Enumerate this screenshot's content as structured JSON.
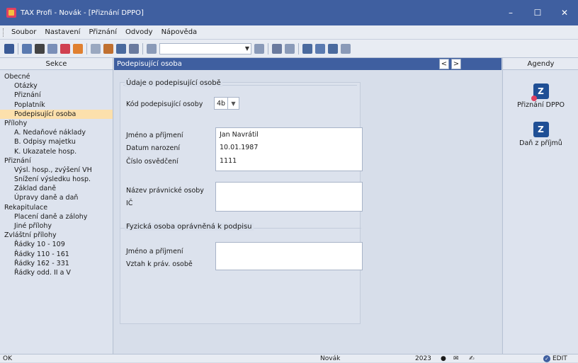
{
  "window": {
    "title": "TAX Profi - Novák - [Přiznání DPPO]",
    "minimize": "–",
    "maximize": "☐",
    "close": "✕"
  },
  "menu": [
    "Soubor",
    "Nastavení",
    "Přiznání",
    "Odvody",
    "Nápověda"
  ],
  "sekce": {
    "title": "Sekce",
    "items": [
      {
        "label": "Obecné",
        "level": 0
      },
      {
        "label": "Otázky",
        "level": 1
      },
      {
        "label": "Přiznání",
        "level": 1
      },
      {
        "label": "Poplatník",
        "level": 1
      },
      {
        "label": "Podepisující osoba",
        "level": 1,
        "selected": true
      },
      {
        "label": "Přílohy",
        "level": 0
      },
      {
        "label": "A. Nedaňové náklady",
        "level": 1
      },
      {
        "label": "B. Odpisy majetku",
        "level": 1
      },
      {
        "label": "K. Ukazatele hosp.",
        "level": 1
      },
      {
        "label": "Přiznání",
        "level": 0
      },
      {
        "label": "Výsl. hosp., zvýšení VH",
        "level": 1
      },
      {
        "label": "Snížení výsledku hosp.",
        "level": 1
      },
      {
        "label": "Základ daně",
        "level": 1
      },
      {
        "label": "Úpravy daně a daň",
        "level": 1
      },
      {
        "label": "Rekapitulace",
        "level": 0
      },
      {
        "label": "Placení daně a zálohy",
        "level": 1
      },
      {
        "label": "Jiné přílohy",
        "level": 1
      },
      {
        "label": "Zvláštní přílohy",
        "level": 0
      },
      {
        "label": "Řádky 10 - 109",
        "level": 1
      },
      {
        "label": "Řádky 110 - 161",
        "level": 1
      },
      {
        "label": "Řádky 162 - 331",
        "level": 1
      },
      {
        "label": "Řádky odd. II a V",
        "level": 1
      }
    ]
  },
  "main": {
    "title": "Podepisující osoba",
    "prev": "<",
    "next": ">",
    "group1": "Údaje o podepisující osobě",
    "kod_label": "Kód podepisující osoby",
    "kod_value": "4b",
    "jmeno_label": "Jméno a příjmení",
    "jmeno_value": "Jan Navrátil",
    "datum_label": "Datum narození",
    "datum_value": "10.01.1987",
    "cislo_label": "Číslo osvědčení",
    "cislo_value": "1111",
    "nazev_label": "Název právnické osoby",
    "ic_label": "IČ",
    "group2": "Fyzická osoba oprávněná k podpisu",
    "jmeno2_label": "Jméno a příjmení",
    "vztah_label": "Vztah k práv. osobě"
  },
  "agendy": {
    "title": "Agendy",
    "items": [
      {
        "label": "Přiznání DPPO",
        "icon": "tax-return-icon"
      },
      {
        "label": "Daň z příjmů",
        "icon": "income-tax-icon"
      }
    ]
  },
  "status": {
    "left": "OK",
    "user": "Novák",
    "year": "2023",
    "edit": "EDIT"
  },
  "colors": {
    "titlebar": "#3f5fa0",
    "selected": "#fce0ac",
    "accent": "#1f4f95"
  }
}
